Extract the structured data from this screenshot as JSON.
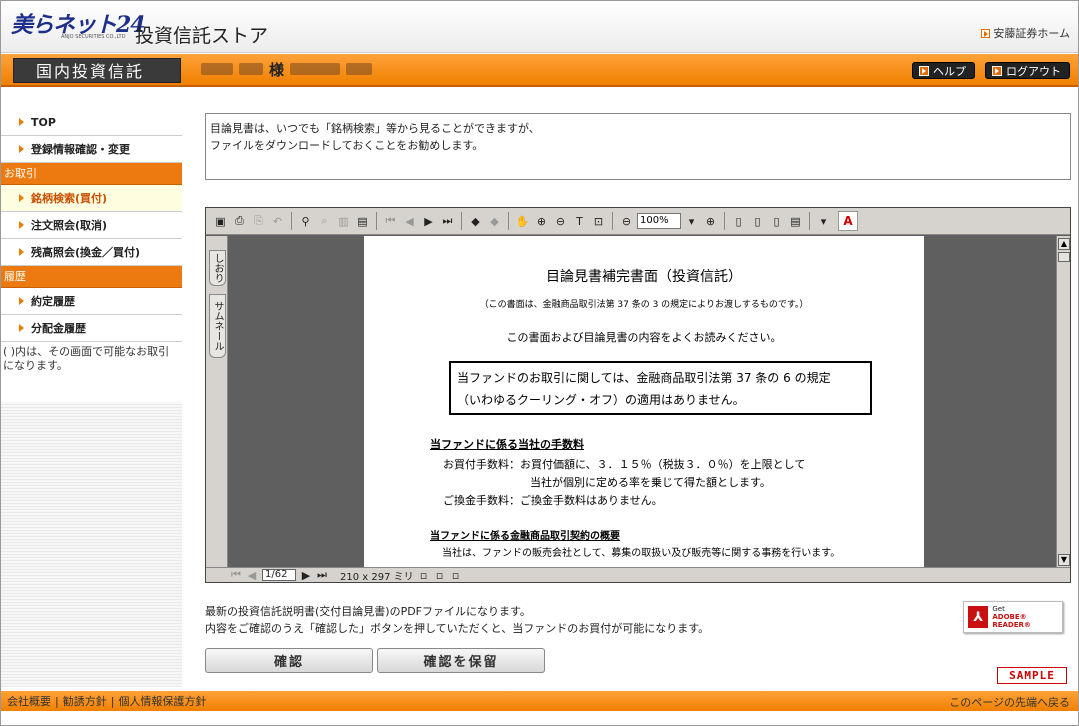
{
  "header": {
    "logo_text": "美らネット24",
    "logo_sub": "ANJO SECURITIES CO.,LTD",
    "store_title": "投資信託ストア",
    "home_link": "安藤証券ホーム"
  },
  "navbar": {
    "section": "国内投資信託",
    "user_suffix": "様",
    "help": "ヘルプ",
    "logout": "ログアウト"
  },
  "sidebar": {
    "top": "TOP",
    "account": "登録情報確認・変更",
    "trade_head": "お取引",
    "items": [
      "銘柄検索(買付)",
      "注文照会(取消)",
      "残高照会(換金／買付)"
    ],
    "history_head": "履歴",
    "history": [
      "約定履歴",
      "分配金履歴"
    ],
    "note": "( )内は、その画面で可能なお取引になります。"
  },
  "notice": {
    "line1": "目論見書は、いつでも「銘柄検索」等から見ることができますが、",
    "line2": "ファイルをダウンロードしておくことをお勧めします。"
  },
  "pdf_viewer": {
    "zoom": "100%",
    "page": "1/62",
    "page_size": "210 x 297 ミリ",
    "tab_bookmarks": "しおり",
    "tab_thumbnails": "サムネール",
    "document": {
      "title": "目論見書補完書面（投資信託）",
      "subtitle": "（この書面は、金融商品取引法第 37 条の 3 の規定によりお渡しするものです。）",
      "read_notice": "この書面および目論見書の内容をよくお読みください。",
      "box_line1": "当ファンドのお取引に関しては、金融商品取引法第 37 条の 6 の規定",
      "box_line2": "（いわゆるクーリング・オフ）の適用はありません。",
      "fee_heading": "当ファンドに係る当社の手数料",
      "fee_buy": "お買付手数料：お買付価額に、３．１５％（税抜３．０％）を上限として",
      "fee_buy2": "当社が個別に定める率を乗じて得た額とします。",
      "fee_exchange": "ご換金手数料：ご換金手数料はありません。",
      "contract_heading": "当ファンドに係る金融商品取引契約の概要",
      "contract_body": "当社は、ファンドの販売会社として、募集の取扱い及び販売等に関する事務を行います。"
    }
  },
  "pdf_note": {
    "line1": "最新の投資信託説明書(交付目論見書)のPDFファイルになります。",
    "line2": "内容をご確認のうえ「確認した」ボタンを押していただくと、当ファンドのお買付が可能になります。"
  },
  "get_reader": {
    "get": "Get",
    "brand": "ADOBE® READER®"
  },
  "buttons": {
    "confirm": "確認",
    "save_confirm": "確認を保留"
  },
  "sample_stamp": "SAMPLE",
  "footer": {
    "company": "会社概要",
    "solicitation": "勧誘方針",
    "privacy": "個人情報保護方針",
    "page_top": "このページの先端へ戻る"
  },
  "colors": {
    "accent": "#f08000",
    "brand": "#1d2f8a"
  }
}
